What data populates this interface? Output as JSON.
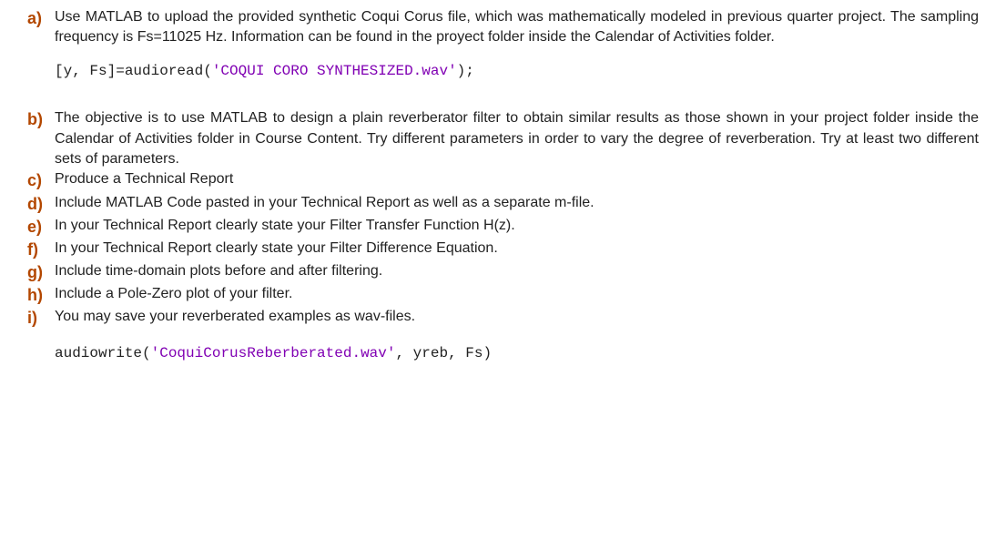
{
  "a": {
    "marker": "a)",
    "text": "Use MATLAB to upload the provided synthetic Coqui Corus file, which was mathematically modeled in previous quarter project. The sampling frequency is Fs=11025 Hz. Information can be found in the proyect folder inside the Calendar of Activities folder.",
    "code_prefix": "[y, Fs]=audioread(",
    "code_str": "'COQUI CORO SYNTHESIZED.wav'",
    "code_suffix": ");"
  },
  "b": {
    "marker": "b)",
    "text": "The objective is to use MATLAB to design a plain reverberator filter to obtain similar results as those shown in your project folder inside the Calendar of Activities folder in Course Content. Try different parameters in order to vary the degree of reverberation. Try at least two different sets of parameters."
  },
  "c": {
    "marker": "c)",
    "text": "Produce a Technical Report"
  },
  "d": {
    "marker": "d)",
    "text": "Include MATLAB Code pasted in your Technical Report as well as a separate m-file."
  },
  "e": {
    "marker": "e)",
    "text": "In your Technical Report clearly state your Filter Transfer Function H(z)."
  },
  "f": {
    "marker": "f)",
    "text": "In your Technical Report clearly state your Filter Difference Equation."
  },
  "g": {
    "marker": "g)",
    "text": "Include time-domain plots before and after filtering."
  },
  "h": {
    "marker": "h)",
    "text": "Include a Pole-Zero plot of your filter."
  },
  "i": {
    "marker": "i)",
    "text": "You may save your reverberated examples as wav-files.",
    "code_prefix": "audiowrite(",
    "code_str": "'CoquiCorusReberberated.wav'",
    "code_suffix": ", yreb, Fs)"
  }
}
